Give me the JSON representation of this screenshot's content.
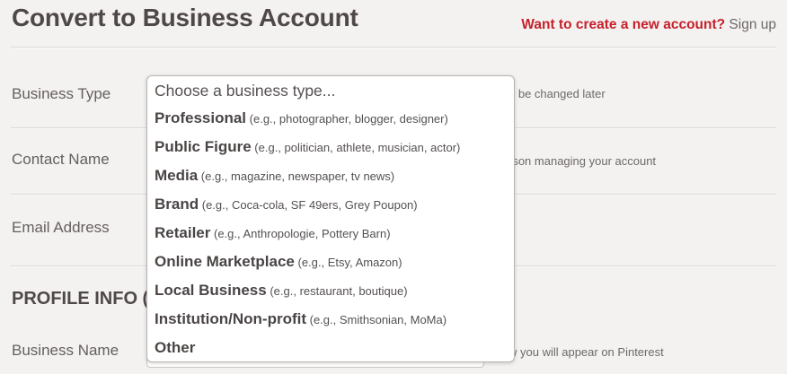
{
  "header": {
    "title": "Convert to Business Account",
    "new_account_prompt": "Want to create a new account?",
    "signup_link": "Sign up"
  },
  "form": {
    "business_type": {
      "label": "Business Type",
      "hint": "n be changed later"
    },
    "contact_name": {
      "label": "Contact Name",
      "hint": "rson managing your account"
    },
    "email_address": {
      "label": "Email Address"
    },
    "profile_section": {
      "heading": "PROFILE INFO ("
    },
    "business_name": {
      "label": "Business Name",
      "hint": "w you will appear on Pinterest"
    }
  },
  "dropdown": {
    "placeholder": "Choose a business type...",
    "options": [
      {
        "label": "Professional",
        "example": " (e.g., photographer, blogger, designer)"
      },
      {
        "label": "Public Figure",
        "example": " (e.g., politician, athlete, musician, actor)"
      },
      {
        "label": "Media",
        "example": " (e.g., magazine, newspaper, tv news)"
      },
      {
        "label": "Brand",
        "example": " (e.g., Coca-cola, SF 49ers, Grey Poupon)"
      },
      {
        "label": "Retailer",
        "example": " (e.g., Anthropologie, Pottery Barn)"
      },
      {
        "label": "Online Marketplace",
        "example": " (e.g., Etsy, Amazon)"
      },
      {
        "label": "Local Business",
        "example": " (e.g., restaurant, boutique)"
      },
      {
        "label": "Institution/Non-profit",
        "example": " (e.g., Smithsonian, MoMa)"
      },
      {
        "label": "Other",
        "example": ""
      }
    ]
  },
  "colors": {
    "background": "#f4f2f0",
    "accent_red": "#c5202b",
    "heading_text": "#4f4848"
  }
}
